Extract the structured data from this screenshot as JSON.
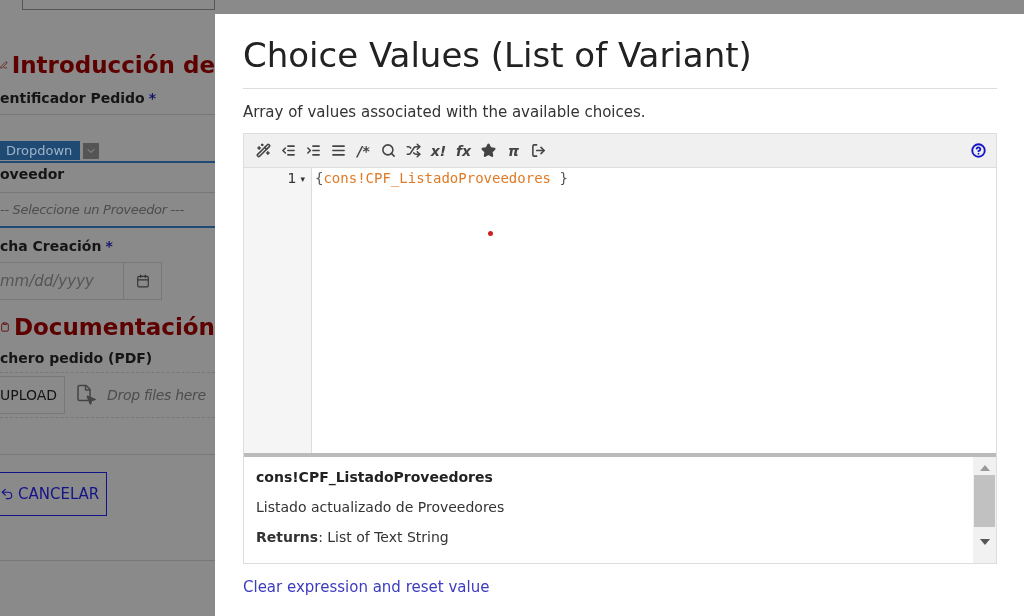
{
  "background_form": {
    "section_1": {
      "title": "Introducción de"
    },
    "field_1": {
      "label": "entificador Pedido",
      "required_mark": "*"
    },
    "dropdown_tab": {
      "label": "Dropdown"
    },
    "field_2": {
      "label": "oveedor",
      "placeholder": "-- Seleccione un Proveedor ---"
    },
    "field_3": {
      "label": "cha Creación",
      "required_mark": "*",
      "placeholder": "mm/dd/yyyy"
    },
    "section_2": {
      "title": "Documentación"
    },
    "field_4": {
      "label": "chero pedido (PDF)",
      "button": "UPLOAD",
      "drop_hint": "Drop files here"
    },
    "cancel_button": "CANCELAR"
  },
  "dialog": {
    "title": "Choice Values (List of Variant)",
    "description": "Array of values associated with the available choices.",
    "toolbar": [
      {
        "kind": "icon"
      },
      {
        "kind": "icon"
      },
      {
        "kind": "icon"
      },
      {
        "kind": "icon"
      },
      {
        "kind": "text",
        "label": "/*"
      },
      {
        "kind": "icon"
      },
      {
        "kind": "icon"
      },
      {
        "kind": "text",
        "label": "x!"
      },
      {
        "kind": "text",
        "label": "fx"
      },
      {
        "kind": "icon"
      },
      {
        "kind": "text",
        "label": "π"
      },
      {
        "kind": "icon"
      }
    ],
    "editor": {
      "lines": [
        {
          "number": "1",
          "fold": "▾",
          "open": "{",
          "code": "cons!CPF_ListadoProveedores",
          "close": " }"
        }
      ]
    },
    "doc": {
      "name": "cons!CPF_ListadoProveedores",
      "description": "Listado actualizado de Proveedores",
      "returns": "**Returns**: List of Text String"
    },
    "link": "Clear expression and reset value"
  }
}
